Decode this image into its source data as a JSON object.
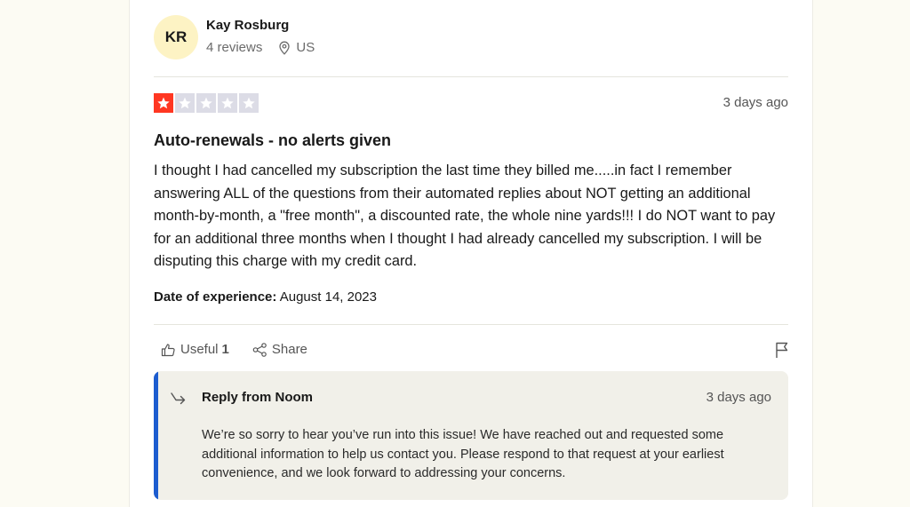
{
  "reviewer": {
    "initials": "KR",
    "name": "Kay Rosburg",
    "reviews_count": "4 reviews",
    "country": "US"
  },
  "review": {
    "rating": 1,
    "max_rating": 5,
    "date_ago": "3 days ago",
    "title": "Auto-renewals - no alerts given",
    "body": "I thought I had cancelled my subscription the last time they billed me.....in fact I remember answering ALL of the questions from their automated replies about NOT getting an additional month-by-month, a \"free month\", a discounted rate, the whole nine yards!!! I do NOT want to pay for an additional three months when I thought I had already cancelled my subscription. I will be disputing this charge with my credit card.",
    "date_of_experience_label": "Date of experience:",
    "date_of_experience": "August 14, 2023"
  },
  "actions": {
    "useful_label": "Useful",
    "useful_count": "1",
    "share_label": "Share"
  },
  "reply": {
    "title": "Reply from Noom",
    "date_ago": "3 days ago",
    "body": "We’re so sorry to hear you’ve run into this issue! We have reached out and requested some additional information to help us contact you. Please respond to that request at your earliest convenience, and we look forward to addressing your concerns."
  },
  "colors": {
    "star_filled": "#ff3722",
    "star_empty": "#dcdce6",
    "reply_accent": "#1c5ccf"
  }
}
